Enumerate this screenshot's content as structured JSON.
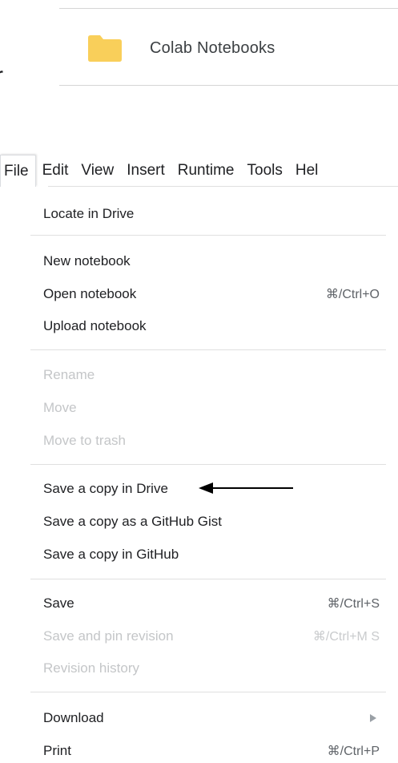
{
  "folder": {
    "name": "Colab Notebooks",
    "icon": "folder-icon",
    "color": "#f9cf5a"
  },
  "cropped_fragment": "r",
  "menubar": {
    "items": [
      {
        "label": "File",
        "active": true
      },
      {
        "label": "Edit"
      },
      {
        "label": "View"
      },
      {
        "label": "Insert"
      },
      {
        "label": "Runtime"
      },
      {
        "label": "Tools"
      },
      {
        "label": "Hel"
      }
    ]
  },
  "file_menu": {
    "groups": [
      [
        {
          "label": "Locate in Drive",
          "enabled": true
        }
      ],
      [
        {
          "label": "New notebook",
          "enabled": true
        },
        {
          "label": "Open notebook",
          "shortcut": "⌘/Ctrl+O",
          "enabled": true
        },
        {
          "label": "Upload notebook",
          "enabled": true
        }
      ],
      [
        {
          "label": "Rename",
          "enabled": false
        },
        {
          "label": "Move",
          "enabled": false
        },
        {
          "label": "Move to trash",
          "enabled": false
        }
      ],
      [
        {
          "label": "Save a copy in Drive",
          "enabled": true,
          "annotated": true
        },
        {
          "label": "Save a copy as a GitHub Gist",
          "enabled": true
        },
        {
          "label": "Save a copy in GitHub",
          "enabled": true
        }
      ],
      [
        {
          "label": "Save",
          "shortcut": "⌘/Ctrl+S",
          "enabled": true
        },
        {
          "label": "Save and pin revision",
          "shortcut": "⌘/Ctrl+M S",
          "enabled": false
        },
        {
          "label": "Revision history",
          "enabled": false
        }
      ],
      [
        {
          "label": "Download",
          "submenu": true,
          "enabled": true
        },
        {
          "label": "Print",
          "shortcut": "⌘/Ctrl+P",
          "enabled": true
        }
      ]
    ]
  },
  "colors": {
    "text": "#202124",
    "disabled_text": "#c4c6c8",
    "divider": "#e0e0e0",
    "annotation_arrow": "#000000"
  }
}
